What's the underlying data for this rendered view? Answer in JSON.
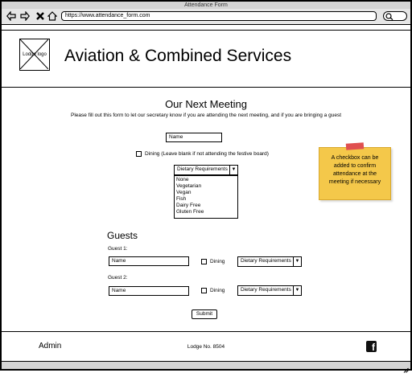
{
  "window": {
    "title": "Attendance Form"
  },
  "browser": {
    "url": "https://www.attendance_form.com",
    "icons": [
      "back-arrow-icon",
      "forward-arrow-icon",
      "close-x-icon",
      "home-icon",
      "search-icon"
    ]
  },
  "header": {
    "logo_label": "Lodge logo",
    "title": "Aviation & Combined Services"
  },
  "form": {
    "heading": "Our Next Meeting",
    "subtitle": "Please fill out this form to let our secretary know if you are attending the next meeting, and if you are bringing a guest",
    "name_value": "Name",
    "dining_label": "Dining (Leave blank if not attending the festive board)",
    "dining_checked": false,
    "dietary_selected": "Dietary Requirements",
    "dietary_options": [
      "None",
      "Vegetarian",
      "Vegan",
      "Fish",
      "Dairy Free",
      "Gluten Free"
    ]
  },
  "sticky_note": {
    "text": "A checkbox can be added to confirm attendance at the meeting if necessary"
  },
  "guests": {
    "heading": "Guests",
    "items": [
      {
        "label": "Guest 1:",
        "name_value": "Name",
        "dining_label": "Dining",
        "dietary_selected": "Dietary Requirements"
      },
      {
        "label": "Guest 2:",
        "name_value": "Name",
        "dining_label": "Dining",
        "dietary_selected": "Dietary Requirements"
      }
    ]
  },
  "submit_label": "Submit",
  "footer": {
    "admin": "Admin",
    "lodge_number": "Lodge No. 8504",
    "social_icon": "facebook-icon"
  }
}
